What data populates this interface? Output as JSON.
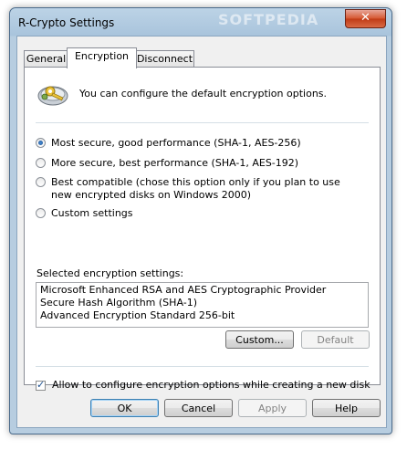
{
  "window": {
    "title": "R-Crypto Settings",
    "watermark": "SOFTPEDIA",
    "close_glyph": "✕"
  },
  "tabs": [
    {
      "label": "General"
    },
    {
      "label": "Encryption"
    },
    {
      "label": "Disconnect"
    }
  ],
  "active_tab": "Encryption",
  "header": {
    "text": "You can configure the default encryption options.",
    "icon": "keys-lock-icon"
  },
  "options": [
    {
      "label": "Most secure, good performance (SHA-1, AES-256)",
      "checked": true
    },
    {
      "label": "More secure, best performance (SHA-1, AES-192)",
      "checked": false
    },
    {
      "label_line1": "Best compatible (chose this option only if you plan to use",
      "label_line2": "new encrypted disks on Windows 2000)",
      "checked": false
    },
    {
      "label": "Custom settings",
      "checked": false
    }
  ],
  "selected_settings": {
    "label": "Selected encryption settings:",
    "lines": [
      "Microsoft Enhanced RSA and AES Cryptographic Provider",
      "Secure Hash Algorithm (SHA-1)",
      "Advanced Encryption Standard 256-bit"
    ]
  },
  "buttons": {
    "custom": "Custom...",
    "default": "Default",
    "ok": "OK",
    "cancel": "Cancel",
    "apply": "Apply",
    "help": "Help"
  },
  "allow_configure": {
    "label": "Allow to configure encryption options while creating a new disk",
    "checked": true
  }
}
